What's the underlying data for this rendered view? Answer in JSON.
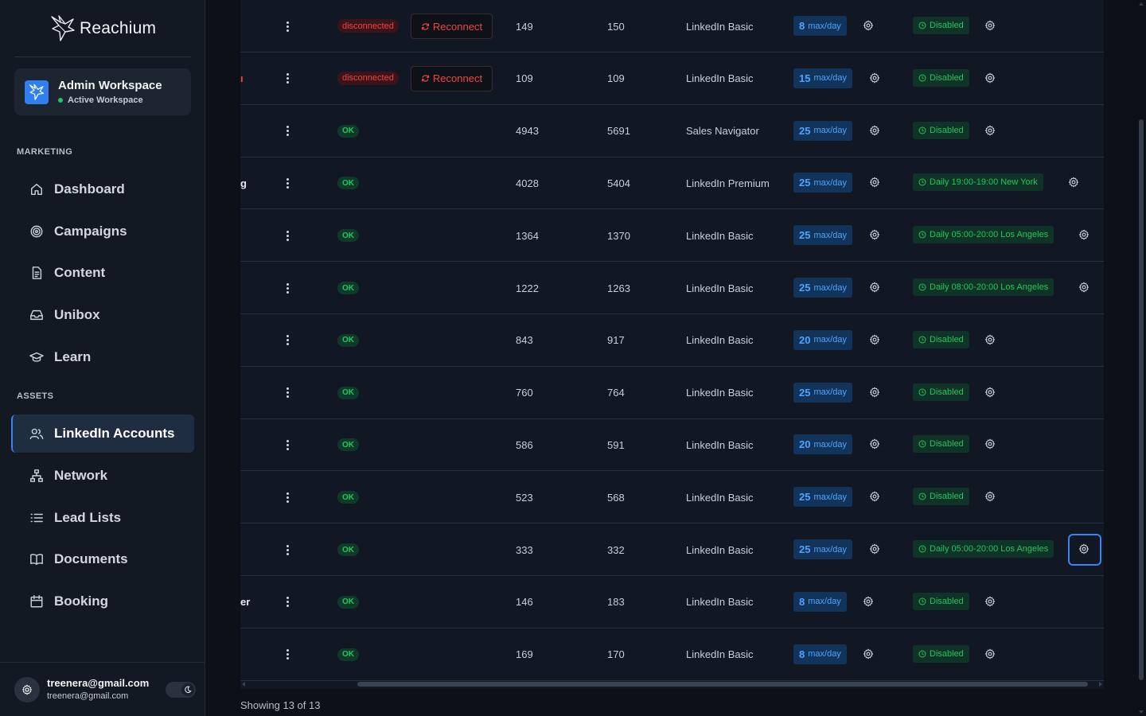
{
  "brand": {
    "name": "Reachium"
  },
  "workspace": {
    "title": "Admin Workspace",
    "status": "Active Workspace"
  },
  "sidebar": {
    "sections": [
      {
        "label": "MARKETING"
      },
      {
        "label": "ASSETS"
      }
    ],
    "items": [
      {
        "label": "Dashboard",
        "icon": "home-icon"
      },
      {
        "label": "Campaigns",
        "icon": "target-icon"
      },
      {
        "label": "Content",
        "icon": "document-icon"
      },
      {
        "label": "Unibox",
        "icon": "inbox-icon"
      },
      {
        "label": "Learn",
        "icon": "graduation-cap-icon"
      },
      {
        "label": "LinkedIn Accounts",
        "icon": "users-icon",
        "active": true
      },
      {
        "label": "Network",
        "icon": "network-icon"
      },
      {
        "label": "Lead Lists",
        "icon": "list-icon"
      },
      {
        "label": "Documents",
        "icon": "book-icon"
      },
      {
        "label": "Booking",
        "icon": "calendar-icon"
      }
    ]
  },
  "user": {
    "email": "treenera@gmail.com",
    "email_secondary": "treenera@gmail.com"
  },
  "table": {
    "reconnect_label": "Reconnect",
    "rows": [
      {
        "name_fragment": "",
        "status": "disconnected",
        "col1": "149",
        "col2": "150",
        "plan": "LinkedIn Basic",
        "limit": "8",
        "limit_unit": "max/day",
        "schedule": "Disabled"
      },
      {
        "name_fragment": "ı",
        "status": "disconnected",
        "col1": "109",
        "col2": "109",
        "plan": "LinkedIn Basic",
        "limit": "15",
        "limit_unit": "max/day",
        "schedule": "Disabled"
      },
      {
        "name_fragment": "",
        "status": "OK",
        "col1": "4943",
        "col2": "5691",
        "plan": "Sales Navigator",
        "limit": "25",
        "limit_unit": "max/day",
        "schedule": "Disabled"
      },
      {
        "name_fragment": "g",
        "status": "OK",
        "col1": "4028",
        "col2": "5404",
        "plan": "LinkedIn Premium",
        "limit": "25",
        "limit_unit": "max/day",
        "schedule": "Daily 19:00-19:00 New York"
      },
      {
        "name_fragment": "",
        "status": "OK",
        "col1": "1364",
        "col2": "1370",
        "plan": "LinkedIn Basic",
        "limit": "25",
        "limit_unit": "max/day",
        "schedule": "Daily 05:00-20:00 Los Angeles"
      },
      {
        "name_fragment": "",
        "status": "OK",
        "col1": "1222",
        "col2": "1263",
        "plan": "LinkedIn Basic",
        "limit": "25",
        "limit_unit": "max/day",
        "schedule": "Daily 08:00-20:00 Los Angeles"
      },
      {
        "name_fragment": "",
        "status": "OK",
        "col1": "843",
        "col2": "917",
        "plan": "LinkedIn Basic",
        "limit": "20",
        "limit_unit": "max/day",
        "schedule": "Disabled"
      },
      {
        "name_fragment": "",
        "status": "OK",
        "col1": "760",
        "col2": "764",
        "plan": "LinkedIn Basic",
        "limit": "25",
        "limit_unit": "max/day",
        "schedule": "Disabled"
      },
      {
        "name_fragment": "",
        "status": "OK",
        "col1": "586",
        "col2": "591",
        "plan": "LinkedIn Basic",
        "limit": "20",
        "limit_unit": "max/day",
        "schedule": "Disabled"
      },
      {
        "name_fragment": "",
        "status": "OK",
        "col1": "523",
        "col2": "568",
        "plan": "LinkedIn Basic",
        "limit": "25",
        "limit_unit": "max/day",
        "schedule": "Disabled"
      },
      {
        "name_fragment": "",
        "status": "OK",
        "col1": "333",
        "col2": "332",
        "plan": "LinkedIn Basic",
        "limit": "25",
        "limit_unit": "max/day",
        "schedule": "Daily 05:00-20:00 Los Angeles",
        "focused": true
      },
      {
        "name_fragment": "er",
        "status": "OK",
        "col1": "146",
        "col2": "183",
        "plan": "LinkedIn Basic",
        "limit": "8",
        "limit_unit": "max/day",
        "schedule": "Disabled"
      },
      {
        "name_fragment": "",
        "status": "OK",
        "col1": "169",
        "col2": "170",
        "plan": "LinkedIn Basic",
        "limit": "8",
        "limit_unit": "max/day",
        "schedule": "Disabled"
      }
    ]
  },
  "footer": {
    "showing": "Showing 13 of 13"
  },
  "colors": {
    "accent": "#3b82f6",
    "ok": "#22c55e",
    "danger": "#ef4444",
    "limit": "#4fa3ff"
  }
}
